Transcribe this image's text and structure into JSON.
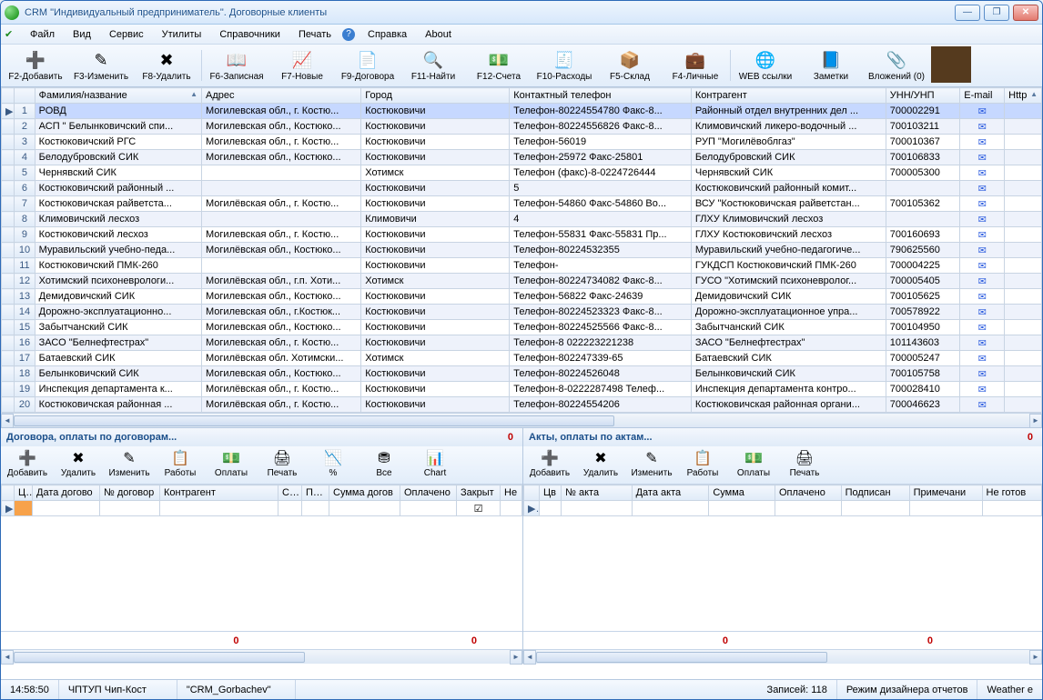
{
  "window": {
    "title": "CRM \"Индивидуальный предприниматель\". Договорные клиенты"
  },
  "menu": [
    "Файл",
    "Вид",
    "Сервис",
    "Утилиты",
    "Справочники",
    "Печать",
    "Справка",
    "About"
  ],
  "toolbar": [
    {
      "label": "F2-Добавить",
      "icon": "➕"
    },
    {
      "label": "F3-Изменить",
      "icon": "✎"
    },
    {
      "label": "F8-Удалить",
      "icon": "✖"
    },
    {
      "label": "F6-Записная",
      "icon": "📖"
    },
    {
      "label": "F7-Новые",
      "icon": "📈"
    },
    {
      "label": "F9-Договора",
      "icon": "📄"
    },
    {
      "label": "F11-Найти",
      "icon": "🔍"
    },
    {
      "label": "F12-Счета",
      "icon": "💵"
    },
    {
      "label": "F10-Расходы",
      "icon": "🧾"
    },
    {
      "label": "F5-Склад",
      "icon": "📦"
    },
    {
      "label": "F4-Личные",
      "icon": "💼"
    },
    {
      "label": "WEB ссылки",
      "icon": "🌐"
    },
    {
      "label": "Заметки",
      "icon": "📘"
    },
    {
      "label": "Вложений (0)",
      "icon": "📎"
    }
  ],
  "grid": {
    "columns": [
      "",
      "",
      "Фамилия/название",
      "Адрес",
      "Город",
      "Контактный телефон",
      "Контрагент",
      "УНН/УНП",
      "E-mail",
      "Http"
    ],
    "rows": [
      {
        "n": "1",
        "sel": true,
        "name": "РОВД",
        "addr": "Могилевская обл., г. Костю...",
        "city": "Костюковичи",
        "phone": "Телефон-80224554780 Факс-8...",
        "kontr": "Районный отдел внутренних дел ...",
        "unp": "700002291"
      },
      {
        "n": "2",
        "name": "АСП \" Белынковичский спи...",
        "addr": "Могилевская обл., Костюко...",
        "city": "Костюковичи",
        "phone": "Телефон-80224556826 Факс-8...",
        "kontr": "Климовичский ликеро-водочный ...",
        "unp": "700103211"
      },
      {
        "n": "3",
        "name": "Костюковичский РГС",
        "addr": "Могилевская обл., г. Костю...",
        "city": "Костюковичи",
        "phone": "Телефон-56019",
        "kontr": "РУП \"Могилёвоблгаз\"",
        "unp": "700010367"
      },
      {
        "n": "4",
        "name": "Белодубровский СИК",
        "addr": "Могилевская обл., Костюко...",
        "city": "Костюковичи",
        "phone": "Телефон-25972 Факс-25801",
        "kontr": "Белодубровский СИК",
        "unp": "700106833"
      },
      {
        "n": "5",
        "name": "Чернявский СИК",
        "addr": "",
        "city": "Хотимск",
        "phone": "Телефон (факс)-8-0224726444",
        "kontr": "Чернявский СИК",
        "unp": "700005300"
      },
      {
        "n": "6",
        "name": "Костюковичский районный ...",
        "addr": "",
        "city": "Костюковичи",
        "phone": "5",
        "kontr": "Костюковичский районный комит...",
        "unp": ""
      },
      {
        "n": "7",
        "name": "Костюковичская райветста...",
        "addr": "Могилёвская обл., г. Костю...",
        "city": "Костюковичи",
        "phone": "Телефон-54860 Факс-54860 Во...",
        "kontr": "ВСУ \"Костюковичская райветстан...",
        "unp": "700105362"
      },
      {
        "n": "8",
        "name": "Климовичский лесхоз",
        "addr": "",
        "city": "Климовичи",
        "phone": "4",
        "kontr": "ГЛХУ Климовичский лесхоз",
        "unp": ""
      },
      {
        "n": "9",
        "name": "Костюковичский  лесхоз",
        "addr": "Могилевская обл., г. Костю...",
        "city": "Костюковичи",
        "phone": "Телефон-55831 Факс-55831 Пр...",
        "kontr": "ГЛХУ Костюковичский лесхоз",
        "unp": "700160693"
      },
      {
        "n": "10",
        "name": "Муравильский учебно-педа...",
        "addr": "Могилёвская обл., Костюко...",
        "city": "Костюковичи",
        "phone": "Телефон-80224532355",
        "kontr": "Муравильский учебно-педагогиче...",
        "unp": "790625560"
      },
      {
        "n": "11",
        "name": "Костюковичский ПМК-260",
        "addr": "",
        "city": "Костюковичи",
        "phone": "Телефон-",
        "kontr": "ГУКДСП Костюковичский ПМК-260",
        "unp": "700004225"
      },
      {
        "n": "12",
        "name": "Хотимский психоневрологи...",
        "addr": "Могилёвская обл., г.п. Хоти...",
        "city": "Хотимск",
        "phone": "Телефон-80224734082 Факс-8...",
        "kontr": "ГУСО \"Хотимский психоневролог...",
        "unp": "700005405"
      },
      {
        "n": "13",
        "name": "Демидовичский СИК",
        "addr": "Могилевская обл., Костюко...",
        "city": "Костюковичи",
        "phone": "Телефон-56822 Факс-24639",
        "kontr": "Демидовичский СИК",
        "unp": "700105625"
      },
      {
        "n": "14",
        "name": "Дорожно-эксплуатационно...",
        "addr": "Могилевская обл., г.Костюк...",
        "city": "Костюковичи",
        "phone": "Телефон-80224523323 Факс-8...",
        "kontr": "Дорожно-эксплуатационное упра...",
        "unp": "700578922"
      },
      {
        "n": "15",
        "name": "Забытчанский СИК",
        "addr": "Могилевская обл., Костюко...",
        "city": "Костюковичи",
        "phone": "Телефон-80224525566 Факс-8...",
        "kontr": "Забытчанский СИК",
        "unp": "700104950"
      },
      {
        "n": "16",
        "name": "ЗАСО \"Белнефтестрах\"",
        "addr": "Могилевская обл., г. Костю...",
        "city": "Костюковичи",
        "phone": "Телефон-8 022223221238",
        "kontr": "ЗАСО \"Белнефтестрах\"",
        "unp": "101143603"
      },
      {
        "n": "17",
        "name": "Батаевский СИК",
        "addr": "Могилёвская обл. Хотимски...",
        "city": "Хотимск",
        "phone": "Телефон-802247339-65",
        "kontr": "Батаевский СИК",
        "unp": "700005247"
      },
      {
        "n": "18",
        "name": "Белынковичский СИК",
        "addr": "Могилевская обл., Костюко...",
        "city": "Костюковичи",
        "phone": "Телефон-80224526048",
        "kontr": "Белынковичский СИК",
        "unp": "700105758"
      },
      {
        "n": "19",
        "name": "Инспекция департамента к...",
        "addr": "Могилёвская обл., г. Костю...",
        "city": "Костюковичи",
        "phone": "Телефон-8-0222287498 Телеф...",
        "kontr": "Инспекция департамента контро...",
        "unp": "700028410"
      },
      {
        "n": "20",
        "name": "Костюковичская районная ...",
        "addr": "Могилёвская обл., г. Костю...",
        "city": "Костюковичи",
        "phone": "Телефон-80224554206",
        "kontr": "Костюковичская районная органи...",
        "unp": "700046623"
      }
    ]
  },
  "panels": {
    "left": {
      "title": "Договора, оплаты по договорам...",
      "count": "0",
      "buttons": [
        {
          "label": "Добавить",
          "icon": "➕"
        },
        {
          "label": "Удалить",
          "icon": "✖"
        },
        {
          "label": "Изменить",
          "icon": "✎"
        },
        {
          "label": "Работы",
          "icon": "📋"
        },
        {
          "label": "Оплаты",
          "icon": "💵"
        },
        {
          "label": "Печать",
          "icon": "🖨"
        },
        {
          "label": "%",
          "icon": "📉"
        },
        {
          "label": "Все",
          "icon": "⛃"
        },
        {
          "label": "Chart",
          "icon": "📊"
        }
      ],
      "columns": [
        "",
        "Цв",
        "Дата догово",
        "№ договор",
        "Контрагент",
        "С...",
        "По...",
        "Сумма догов",
        "Оплачено",
        "Закрыт",
        "Не"
      ],
      "footzero": "0"
    },
    "right": {
      "title": "Акты, оплаты по актам...",
      "count": "0",
      "buttons": [
        {
          "label": "Добавить",
          "icon": "➕"
        },
        {
          "label": "Удалить",
          "icon": "✖"
        },
        {
          "label": "Изменить",
          "icon": "✎"
        },
        {
          "label": "Работы",
          "icon": "📋"
        },
        {
          "label": "Оплаты",
          "icon": "💵"
        },
        {
          "label": "Печать",
          "icon": "🖨"
        }
      ],
      "columns": [
        "",
        "Цв",
        "№ акта",
        "Дата акта",
        "Сумма",
        "Оплачено",
        "Подписан",
        "Примечани",
        "Не готов"
      ],
      "footzero": "0"
    }
  },
  "status": {
    "time": "14:58:50",
    "org": "ЧПТУП Чип-Кост",
    "db": "\"CRM_Gorbachev\"",
    "records": "Записей: 118",
    "mode": "Режим дизайнера отчетов",
    "weather": "Weather e"
  }
}
